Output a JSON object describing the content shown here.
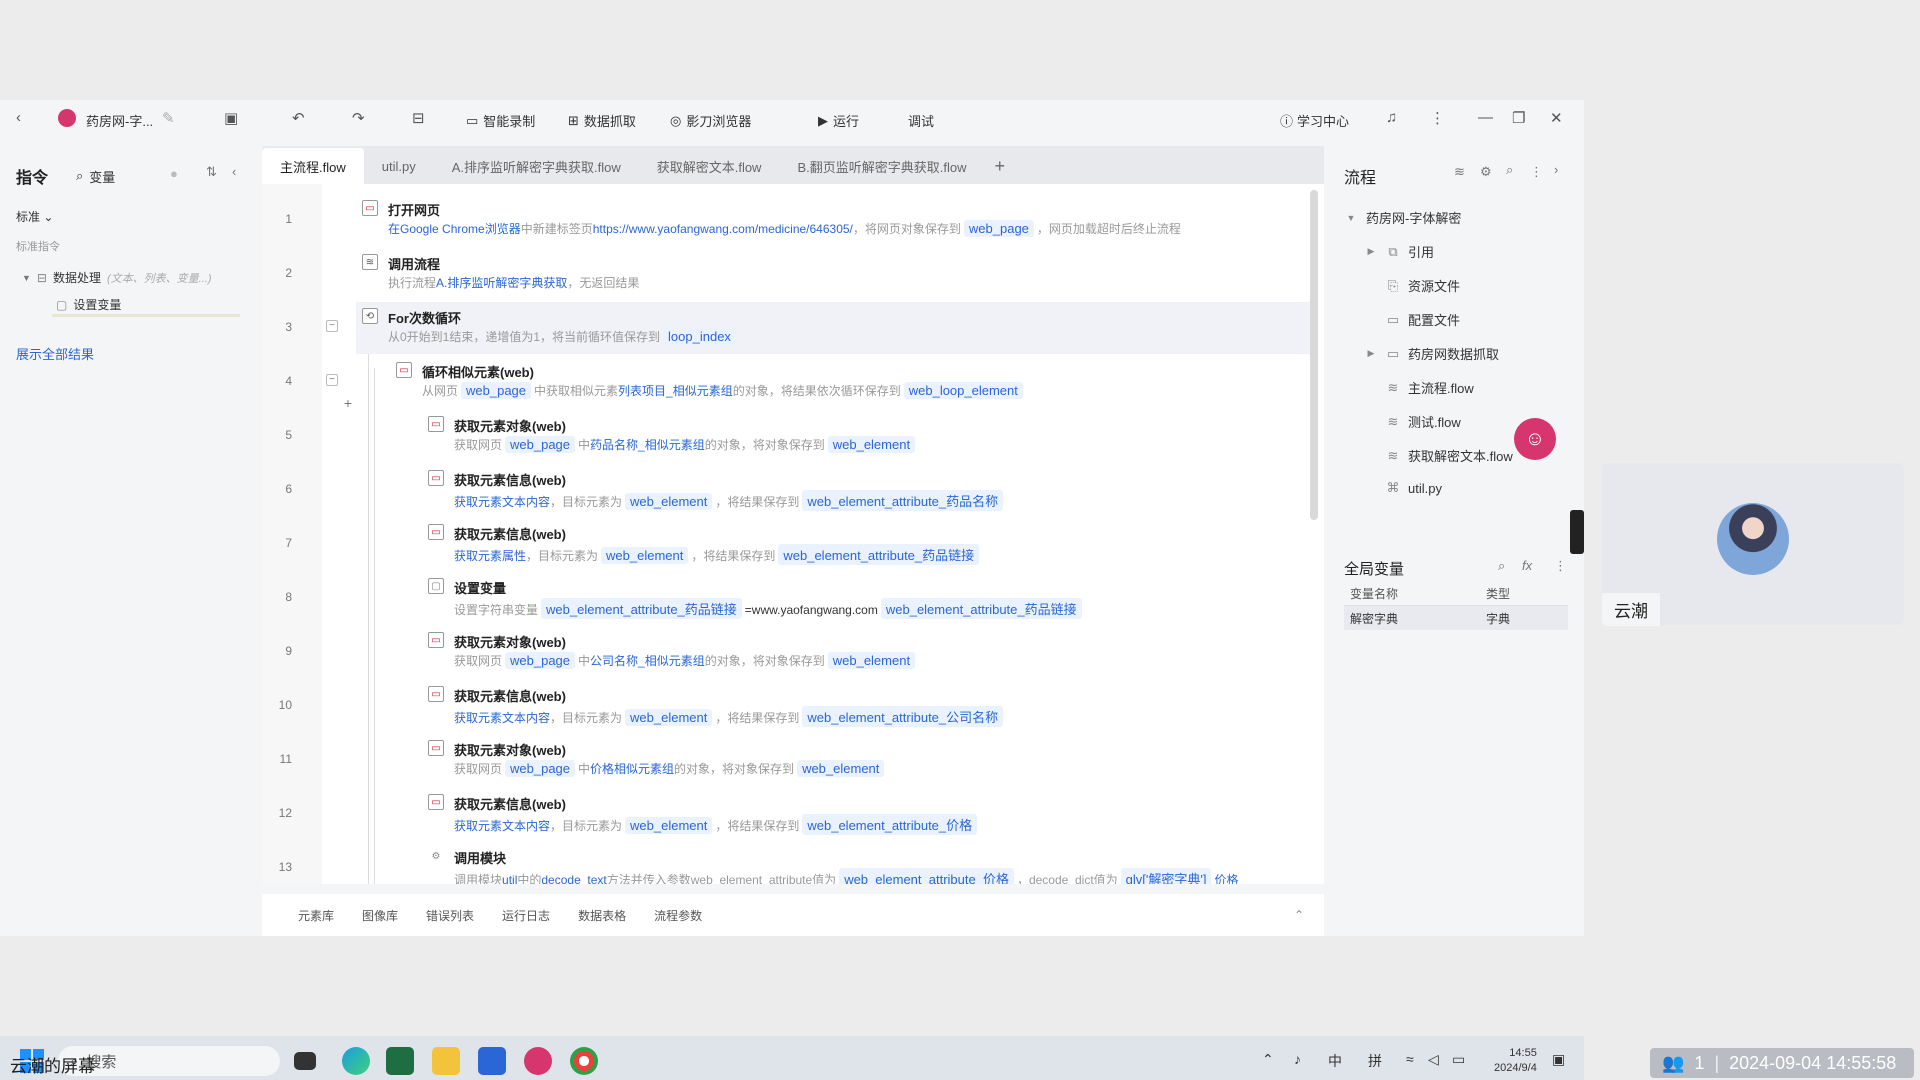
{
  "window": {
    "project_name": "药房网-字...",
    "toolbar": {
      "smart_record": "智能录制",
      "data_scrape": "数据抓取",
      "browser": "影刀浏览器",
      "run": "运行",
      "debug": "调试",
      "learning_center": "学习中心"
    }
  },
  "left_panel": {
    "title": "指令",
    "var_tab": "变量",
    "mode": "标准",
    "category": "标准指令",
    "tree_item": "数据处理",
    "tree_item_hint": "(文本、列表、变量...)",
    "tree_subitem": "设置变量",
    "show_all": "展示全部结果"
  },
  "tabs": [
    {
      "label": "主流程.flow",
      "active": true
    },
    {
      "label": "util.py",
      "active": false
    },
    {
      "label": "A.排序监听解密字典获取.flow",
      "active": false
    },
    {
      "label": "获取解密文本.flow",
      "active": false
    },
    {
      "label": "B.翻页监听解密字典获取.flow",
      "active": false
    }
  ],
  "steps": [
    {
      "n": "1",
      "title": "打开网页",
      "desc": {
        "a": "在Google Chrome浏览器",
        "b": "中新建标签页",
        "c": "https://www.yaofangwang.com/medicine/646305/",
        "d": "，将网页对象保存到",
        "e": "web_page",
        "f": "，网页加载超时后终止流程"
      }
    },
    {
      "n": "2",
      "title": "调用流程",
      "desc": {
        "a": "执行流程",
        "b": "A.排序监听解密字典获取",
        "c": "，无返回结果"
      }
    },
    {
      "n": "3",
      "title": "For次数循环",
      "desc": {
        "a": "从0开始到1结束，递增值为1，将当前循环值保存到",
        "b": "loop_index"
      }
    },
    {
      "n": "4",
      "title": "循环相似元素(web)",
      "desc": {
        "a": "从网页",
        "b": "web_page",
        "c": "中获取相似元素",
        "d": "列表项目_相似元素组",
        "e": "的对象，将结果依次循环保存到",
        "f": "web_loop_element"
      }
    },
    {
      "n": "5",
      "title": "获取元素对象(web)",
      "desc": {
        "a": "获取网页",
        "b": "web_page",
        "c": "中",
        "d": "药品名称_相似元素组",
        "e": "的对象，将对象保存到",
        "f": "web_element"
      }
    },
    {
      "n": "6",
      "title": "获取元素信息(web)",
      "desc": {
        "a": "获取元素文本内容",
        "b": "，目标元素为",
        "c": "web_element",
        "d": "，将结果保存到",
        "e": "web_element_attribute_药品名称"
      }
    },
    {
      "n": "7",
      "title": "获取元素信息(web)",
      "desc": {
        "a": "获取元素属性",
        "b": "，目标元素为",
        "c": "web_element",
        "d": "，将结果保存到",
        "e": "web_element_attribute_药品链接"
      }
    },
    {
      "n": "8",
      "title": "设置变量",
      "desc": {
        "a": "设置字符串变量",
        "b": "web_element_attribute_药品链接",
        "c": "=www.yaofangwang.com",
        "d": "web_element_attribute_药品链接"
      }
    },
    {
      "n": "9",
      "title": "获取元素对象(web)",
      "desc": {
        "a": "获取网页",
        "b": "web_page",
        "c": "中",
        "d": "公司名称_相似元素组",
        "e": "的对象，将对象保存到",
        "f": "web_element"
      }
    },
    {
      "n": "10",
      "title": "获取元素信息(web)",
      "desc": {
        "a": "获取元素文本内容",
        "b": "，目标元素为",
        "c": "web_element",
        "d": "，将结果保存到",
        "e": "web_element_attribute_公司名称"
      }
    },
    {
      "n": "11",
      "title": "获取元素对象(web)",
      "desc": {
        "a": "获取网页",
        "b": "web_page",
        "c": "中",
        "d": "价格相似元素组",
        "e": "的对象，将对象保存到",
        "f": "web_element"
      }
    },
    {
      "n": "12",
      "title": "获取元素信息(web)",
      "desc": {
        "a": "获取元素文本内容",
        "b": "，目标元素为",
        "c": "web_element",
        "d": "，将结果保存到",
        "e": "web_element_attribute_价格"
      }
    },
    {
      "n": "13",
      "title": "调用模块",
      "desc": {
        "a": "调用模块",
        "b": "util",
        "c": "中的",
        "d": "decode_text",
        "e": "方法并传入参数web_element_attribute值为",
        "f": "web_element_attribute_价格",
        "g": "，decode_dict值为",
        "h": "glv['解密字典']",
        "i": "价格"
      }
    }
  ],
  "bottom_tabs": [
    "元素库",
    "图像库",
    "错误列表",
    "运行日志",
    "数据表格",
    "流程参数"
  ],
  "right_panel": {
    "title": "流程",
    "root": "药房网-字体解密",
    "items": [
      "引用",
      "资源文件",
      "配置文件",
      "药房网数据抓取",
      "主流程.flow",
      "测试.flow",
      "获取解密文本.flow",
      "util.py"
    ],
    "global_vars_title": "全局变量",
    "gv_col_name": "变量名称",
    "gv_col_type": "类型",
    "gv_rows": [
      {
        "name": "解密字典",
        "type": "字典"
      }
    ]
  },
  "taskbar": {
    "search": "搜索",
    "ime1": "中",
    "ime2": "拼",
    "time": "14:55",
    "date": "2024/9/4"
  },
  "camera": {
    "name": "云潮"
  },
  "screen_label": "云潮的屏幕",
  "status_bar": {
    "participants": "1",
    "timestamp": "2024-09-04 14:55:58"
  },
  "colors": {
    "accent": "#2a66d6",
    "brand": "#d7356e"
  }
}
